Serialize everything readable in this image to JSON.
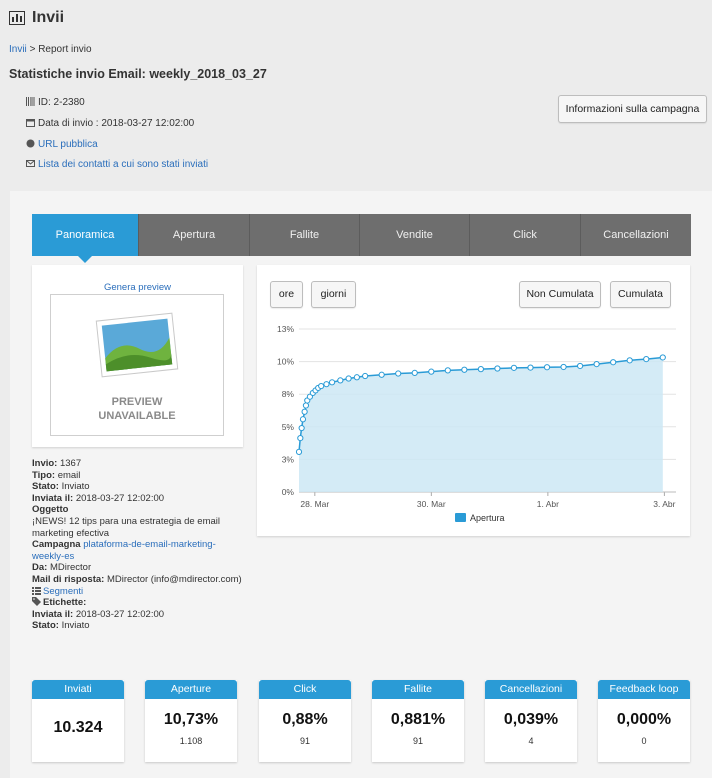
{
  "header": {
    "title": "Invii"
  },
  "breadcrumb": {
    "link": "Invii",
    "sep": ">",
    "current": "Report invio"
  },
  "page_title": "Statistiche invio Email: weekly_2018_03_27",
  "meta": {
    "id": "ID: 2-2380",
    "date": "Data di invio : 2018-03-27 12:02:00",
    "public_url": "URL pubblica",
    "contacts_link": "Lista dei contatti a cui sono stati inviati"
  },
  "campaign_info_button": "Informazioni sulla campagna",
  "tabs": [
    {
      "label": "Panoramica",
      "active": true
    },
    {
      "label": "Apertura",
      "active": false
    },
    {
      "label": "Fallite",
      "active": false
    },
    {
      "label": "Vendite",
      "active": false
    },
    {
      "label": "Click",
      "active": false
    },
    {
      "label": "Cancellazioni",
      "active": false
    }
  ],
  "preview": {
    "link": "Genera preview",
    "line1": "PREVIEW",
    "line2": "UNAVAILABLE"
  },
  "chart_controls": {
    "hours": "ore",
    "days": "giorni",
    "non_cumulative": "Non Cumulata",
    "cumulative": "Cumulata"
  },
  "info": {
    "invio_label": "Invio:",
    "invio_value": "1367",
    "tipo_label": "Tipo:",
    "tipo_value": "email",
    "stato_label": "Stato:",
    "stato_value": "Inviato",
    "inviata_label": "Inviata il:",
    "inviata_value": "2018-03-27 12:02:00",
    "oggetto_label": "Oggetto",
    "oggetto_value": "¡NEWS! 12 tips para una estrategia de email marketing efectiva",
    "campagna_label": "Campagna",
    "campagna_value": "plataforma-de-email-marketing-weekly-es",
    "da_label": "Da:",
    "da_value": "MDirector",
    "mail_label": "Mail di risposta:",
    "mail_value": "MDirector (info@mdirector.com)",
    "segmenti": "Segmenti",
    "etichette_label": "Etichette:",
    "inviata2_label": "Inviata il:",
    "inviata2_value": "2018-03-27 12:02:00",
    "stato2_label": "Stato:",
    "stato2_value": "Inviato"
  },
  "stats": [
    {
      "label": "Inviati",
      "value": "10.324",
      "sub": ""
    },
    {
      "label": "Aperture",
      "value": "10,73%",
      "sub": "1.108"
    },
    {
      "label": "Click",
      "value": "0,88%",
      "sub": "91"
    },
    {
      "label": "Fallite",
      "value": "0,881%",
      "sub": "91"
    },
    {
      "label": "Cancellazioni",
      "value": "0,039%",
      "sub": "4"
    },
    {
      "label": "Feedback loop",
      "value": "0,000%",
      "sub": "0"
    }
  ],
  "colors": {
    "accent": "#2a9bd6",
    "tab_bg": "#6e6e6e",
    "area_fill": "#cde8f5",
    "line": "#2a9bd6"
  },
  "chart_data": {
    "type": "area",
    "series": [
      {
        "name": "Apertura",
        "x": [
          0,
          0.04,
          0.08,
          0.12,
          0.17,
          0.21,
          0.25,
          0.33,
          0.42,
          0.5,
          0.58,
          0.67,
          0.83,
          1,
          1.25,
          1.5,
          1.75,
          2,
          2.5,
          3,
          3.5,
          4,
          4.5,
          5,
          5.5,
          6,
          6.5,
          7,
          7.5,
          8,
          8.5,
          9,
          9.5,
          10,
          10.5,
          11
        ],
        "values": [
          3.2,
          4.3,
          5.1,
          5.8,
          6.4,
          6.9,
          7.3,
          7.6,
          7.9,
          8.1,
          8.3,
          8.45,
          8.6,
          8.75,
          8.9,
          9.05,
          9.15,
          9.25,
          9.35,
          9.45,
          9.5,
          9.6,
          9.7,
          9.75,
          9.8,
          9.85,
          9.9,
          9.92,
          9.95,
          9.97,
          10.05,
          10.2,
          10.35,
          10.5,
          10.6,
          10.73
        ]
      }
    ],
    "x_ticks": [
      "28. Mar",
      "30. Mar",
      "1. Abr",
      "3. Abr"
    ],
    "y_ticks": [
      "0%",
      "3%",
      "5%",
      "8%",
      "10%",
      "13%"
    ],
    "ylim": [
      0,
      13
    ],
    "legend": "bottom-center",
    "grid": true
  }
}
